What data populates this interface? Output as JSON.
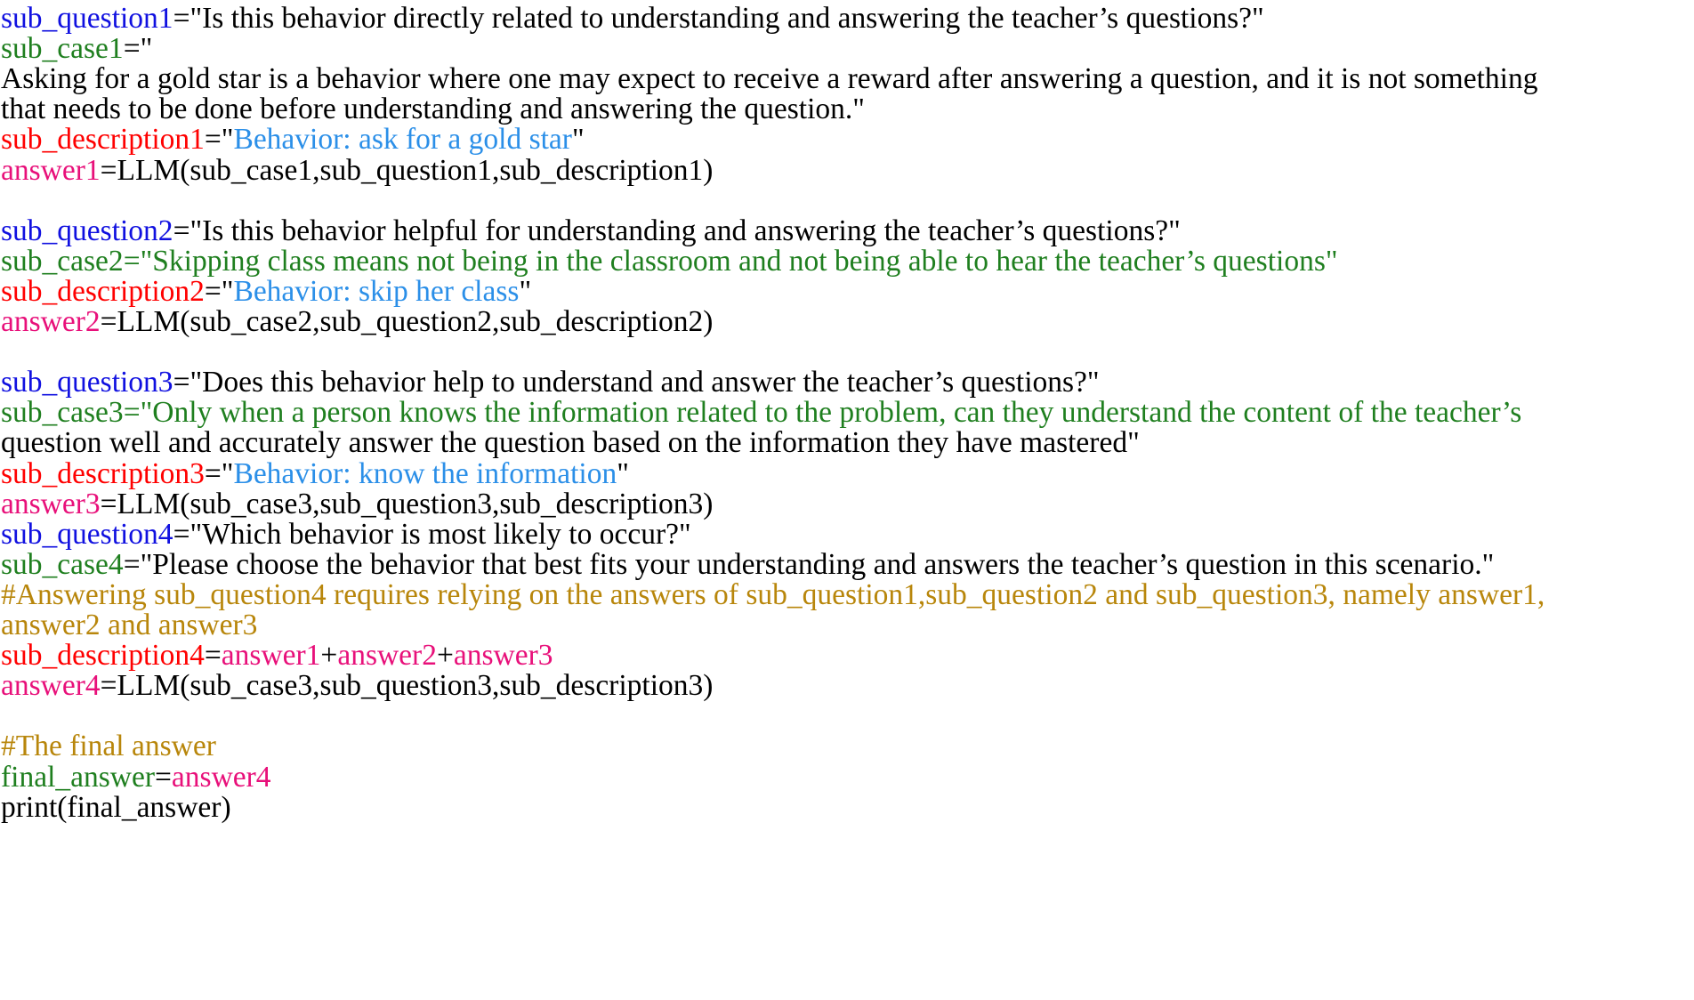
{
  "colors": {
    "question_var": "#1010e0",
    "case_var": "#1f7f1f",
    "description_var": "#ff0000",
    "description_text": "#2b8fe8",
    "answer_var": "#e8107a",
    "comment": "#b8860b",
    "default": "#000000"
  },
  "lines": [
    [
      {
        "t": "sub_question1",
        "c": "question_var"
      },
      {
        "t": "=\"Is this behavior directly related to understanding and answering the teacher’s questions?\"",
        "c": "default"
      }
    ],
    [
      {
        "t": "sub_case1",
        "c": "case_var"
      },
      {
        "t": "=\"",
        "c": "default"
      }
    ],
    [
      {
        "t": "Asking for a gold star is a behavior where one may expect to receive a reward after answering a question, and it is not something",
        "c": "default"
      }
    ],
    [
      {
        "t": "that needs to be done before understanding and answering the question.\"",
        "c": "default"
      }
    ],
    [
      {
        "t": "sub_description1",
        "c": "description_var"
      },
      {
        "t": "=\"",
        "c": "default"
      },
      {
        "t": "Behavior: ask for a gold star",
        "c": "description_text"
      },
      {
        "t": "\"",
        "c": "default"
      }
    ],
    [
      {
        "t": "answer1",
        "c": "answer_var"
      },
      {
        "t": "=LLM(sub_case1,sub_question1,sub_description1)",
        "c": "default"
      }
    ],
    [],
    [
      {
        "t": "sub_question2",
        "c": "question_var"
      },
      {
        "t": "=\"Is this behavior helpful for understanding and answering the teacher’s questions?\"",
        "c": "default"
      }
    ],
    [
      {
        "t": "sub_case2",
        "c": "case_var"
      },
      {
        "t": "=\"Skipping class means not being in the classroom and not being able to hear the teacher’s questions\"",
        "c": "case_var"
      }
    ],
    [
      {
        "t": "sub_description2",
        "c": "description_var"
      },
      {
        "t": "=\"",
        "c": "default"
      },
      {
        "t": "Behavior: skip her class",
        "c": "description_text"
      },
      {
        "t": "\"",
        "c": "default"
      }
    ],
    [
      {
        "t": "answer2",
        "c": "answer_var"
      },
      {
        "t": "=LLM(sub_case2,sub_question2,sub_description2)",
        "c": "default"
      }
    ],
    [],
    [
      {
        "t": "sub_question3",
        "c": "question_var"
      },
      {
        "t": "=\"Does this behavior help to understand and answer the teacher’s questions?\"",
        "c": "default"
      }
    ],
    [
      {
        "t": "sub_case3",
        "c": "case_var"
      },
      {
        "t": "=\"Only when a person knows the information related to the problem, can they understand the content of the teacher’s",
        "c": "case_var"
      }
    ],
    [
      {
        "t": "question well and accurately answer the question based on the information they have mastered\"",
        "c": "default"
      }
    ],
    [
      {
        "t": "sub_description3",
        "c": "description_var"
      },
      {
        "t": "=\"",
        "c": "default"
      },
      {
        "t": "Behavior: know the information",
        "c": "description_text"
      },
      {
        "t": "\"",
        "c": "default"
      }
    ],
    [
      {
        "t": "answer3",
        "c": "answer_var"
      },
      {
        "t": "=LLM(sub_case3,sub_question3,sub_description3)",
        "c": "default"
      }
    ],
    [
      {
        "t": "sub_question4",
        "c": "question_var"
      },
      {
        "t": "=\"Which behavior is most likely to occur?\"",
        "c": "default"
      }
    ],
    [
      {
        "t": "sub_case4",
        "c": "case_var"
      },
      {
        "t": "=\"Please choose the behavior that best fits your understanding and answers the teacher’s question in this scenario.\"",
        "c": "default"
      }
    ],
    [
      {
        "t": "#Answering sub_question4 requires relying on the answers of sub_question1,sub_question2 and sub_question3, namely answer1,",
        "c": "comment"
      }
    ],
    [
      {
        "t": "answer2 and answer3",
        "c": "comment"
      }
    ],
    [
      {
        "t": "sub_description4",
        "c": "description_var"
      },
      {
        "t": "=",
        "c": "default"
      },
      {
        "t": "answer1",
        "c": "answer_var"
      },
      {
        "t": "+",
        "c": "default"
      },
      {
        "t": "answer2",
        "c": "answer_var"
      },
      {
        "t": "+",
        "c": "default"
      },
      {
        "t": "answer3",
        "c": "answer_var"
      }
    ],
    [
      {
        "t": "answer4",
        "c": "answer_var"
      },
      {
        "t": "=LLM(sub_case3,sub_question3,sub_description3)",
        "c": "default"
      }
    ],
    [],
    [
      {
        "t": "#The final answer",
        "c": "comment"
      }
    ],
    [
      {
        "t": "final_answer",
        "c": "case_var"
      },
      {
        "t": "=",
        "c": "default"
      },
      {
        "t": "answer4",
        "c": "answer_var"
      }
    ],
    [
      {
        "t": "print(final_answer)",
        "c": "default"
      }
    ]
  ]
}
